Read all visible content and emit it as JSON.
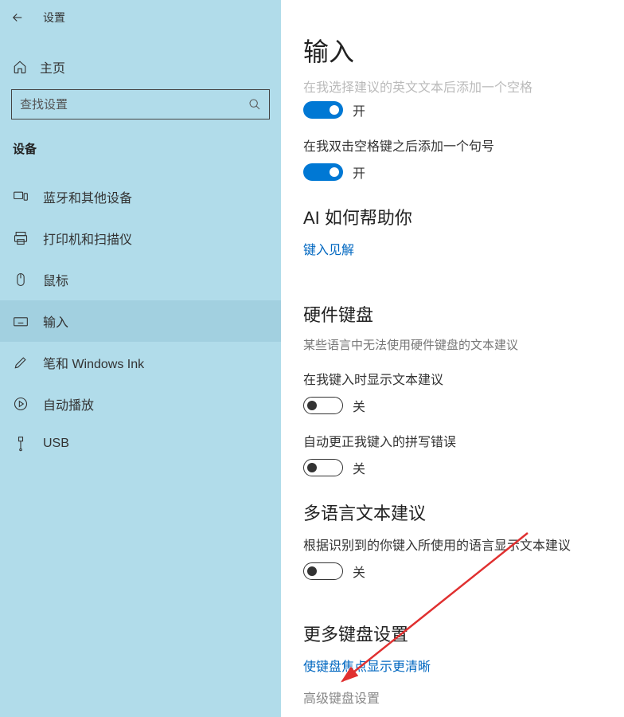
{
  "header": {
    "settings_label": "设置"
  },
  "sidebar": {
    "home_label": "主页",
    "search_placeholder": "查找设置",
    "section": "设备",
    "items": [
      {
        "label": "蓝牙和其他设备",
        "name": "bluetooth"
      },
      {
        "label": "打印机和扫描仪",
        "name": "printers"
      },
      {
        "label": "鼠标",
        "name": "mouse"
      },
      {
        "label": "输入",
        "name": "typing"
      },
      {
        "label": "笔和 Windows Ink",
        "name": "pen"
      },
      {
        "label": "自动播放",
        "name": "autoplay"
      },
      {
        "label": "USB",
        "name": "usb"
      }
    ]
  },
  "content": {
    "title": "输入",
    "clipped_desc": "在我选择建议的英文文本后添加一个空格",
    "toggle1": {
      "state": "on",
      "label": "开"
    },
    "desc2": "在我双击空格键之后添加一个句号",
    "toggle2": {
      "state": "on",
      "label": "开"
    },
    "ai_section": "AI 如何帮助你",
    "ai_link": "键入见解",
    "hw_section": "硬件键盘",
    "hw_sub": "某些语言中无法使用硬件键盘的文本建议",
    "hw_desc1": "在我键入时显示文本建议",
    "toggle3": {
      "state": "off",
      "label": "关"
    },
    "hw_desc2": "自动更正我键入的拼写错误",
    "toggle4": {
      "state": "off",
      "label": "关"
    },
    "ml_section": "多语言文本建议",
    "ml_desc": "根据识别到的你键入所使用的语言显示文本建议",
    "toggle5": {
      "state": "off",
      "label": "关"
    },
    "more_section": "更多键盘设置",
    "more_link1": "使键盘焦点显示更清晰",
    "more_link2": "高级键盘设置"
  }
}
